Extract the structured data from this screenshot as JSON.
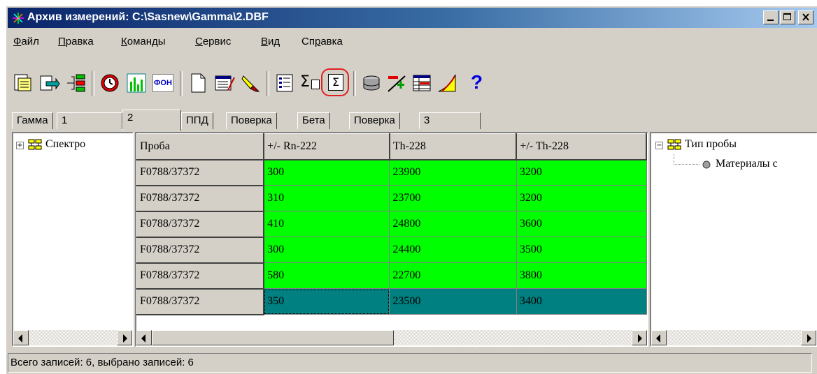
{
  "window": {
    "title": "Архив измерений: C:\\Sasnew\\Gamma\\2.DBF",
    "title_bar_buttons": [
      "minimize-icon",
      "maximize-icon",
      "close-icon"
    ]
  },
  "menu": [
    {
      "label": "Файл",
      "key": "Ф",
      "rest": "айл"
    },
    {
      "label": "Правка",
      "key": "П",
      "rest": "равка"
    },
    {
      "label": "Команды",
      "key": "К",
      "rest": "оманды"
    },
    {
      "label": "Сервис",
      "key": "С",
      "rest": "ервис"
    },
    {
      "label": "Вид",
      "key": "В",
      "rest": "ид"
    },
    {
      "label": "Справка",
      "key": "Спр",
      "keyfirst": "С",
      "mid": "п",
      "u": "р",
      "rest": "авка"
    }
  ],
  "toolbar": {
    "icons": [
      "import-icon",
      "export-icon",
      "tree-merge-icon",
      "clock-icon",
      "spectrum-chart-icon",
      "background-icon",
      "new-document-icon",
      "edit-record-icon",
      "filter-icon",
      "list-icon",
      "sum-icon",
      "sum-selected-icon",
      "database-icon",
      "add-record-icon",
      "table-icon",
      "calibration-icon",
      "help-icon"
    ],
    "background_label": "ФОН",
    "sum_label": "Σ",
    "help_label": "?"
  },
  "tabs": [
    {
      "label": "Гамма",
      "active": false
    },
    {
      "label": "1",
      "active": false
    },
    {
      "label": "2",
      "active": true
    },
    {
      "label": "ППД",
      "active": false
    },
    {
      "label": "Поверка",
      "active": false
    },
    {
      "label": "Бета",
      "active": false
    },
    {
      "label": "Поверка",
      "active": false
    },
    {
      "label": "3",
      "active": false
    }
  ],
  "left_tree": {
    "root": "Спектро"
  },
  "grid": {
    "columns": [
      "Проба",
      "+/- Rn-222",
      "Th-228",
      "+/- Th-228"
    ],
    "rows": [
      [
        "F0788/37372",
        "300",
        "23900",
        "3200"
      ],
      [
        "F0788/37372",
        "310",
        "23700",
        "3200"
      ],
      [
        "F0788/37372",
        "410",
        "24800",
        "3600"
      ],
      [
        "F0788/37372",
        "300",
        "24400",
        "3500"
      ],
      [
        "F0788/37372",
        "580",
        "22700",
        "3800"
      ],
      [
        "F0788/37372",
        "350",
        "23500",
        "3400"
      ]
    ],
    "selected_row": 5,
    "row_color": "#00ff00",
    "selected_color": "#008080"
  },
  "right_tree": {
    "root": "Тип пробы",
    "child": "Материалы с"
  },
  "status": {
    "text": "Всего записей: 6, выбрано записей: 6"
  },
  "colors": {
    "title_start": "#0a246a",
    "title_end": "#a6caf0",
    "face": "#d4d0c8",
    "highlight_circle": "#e02020"
  }
}
